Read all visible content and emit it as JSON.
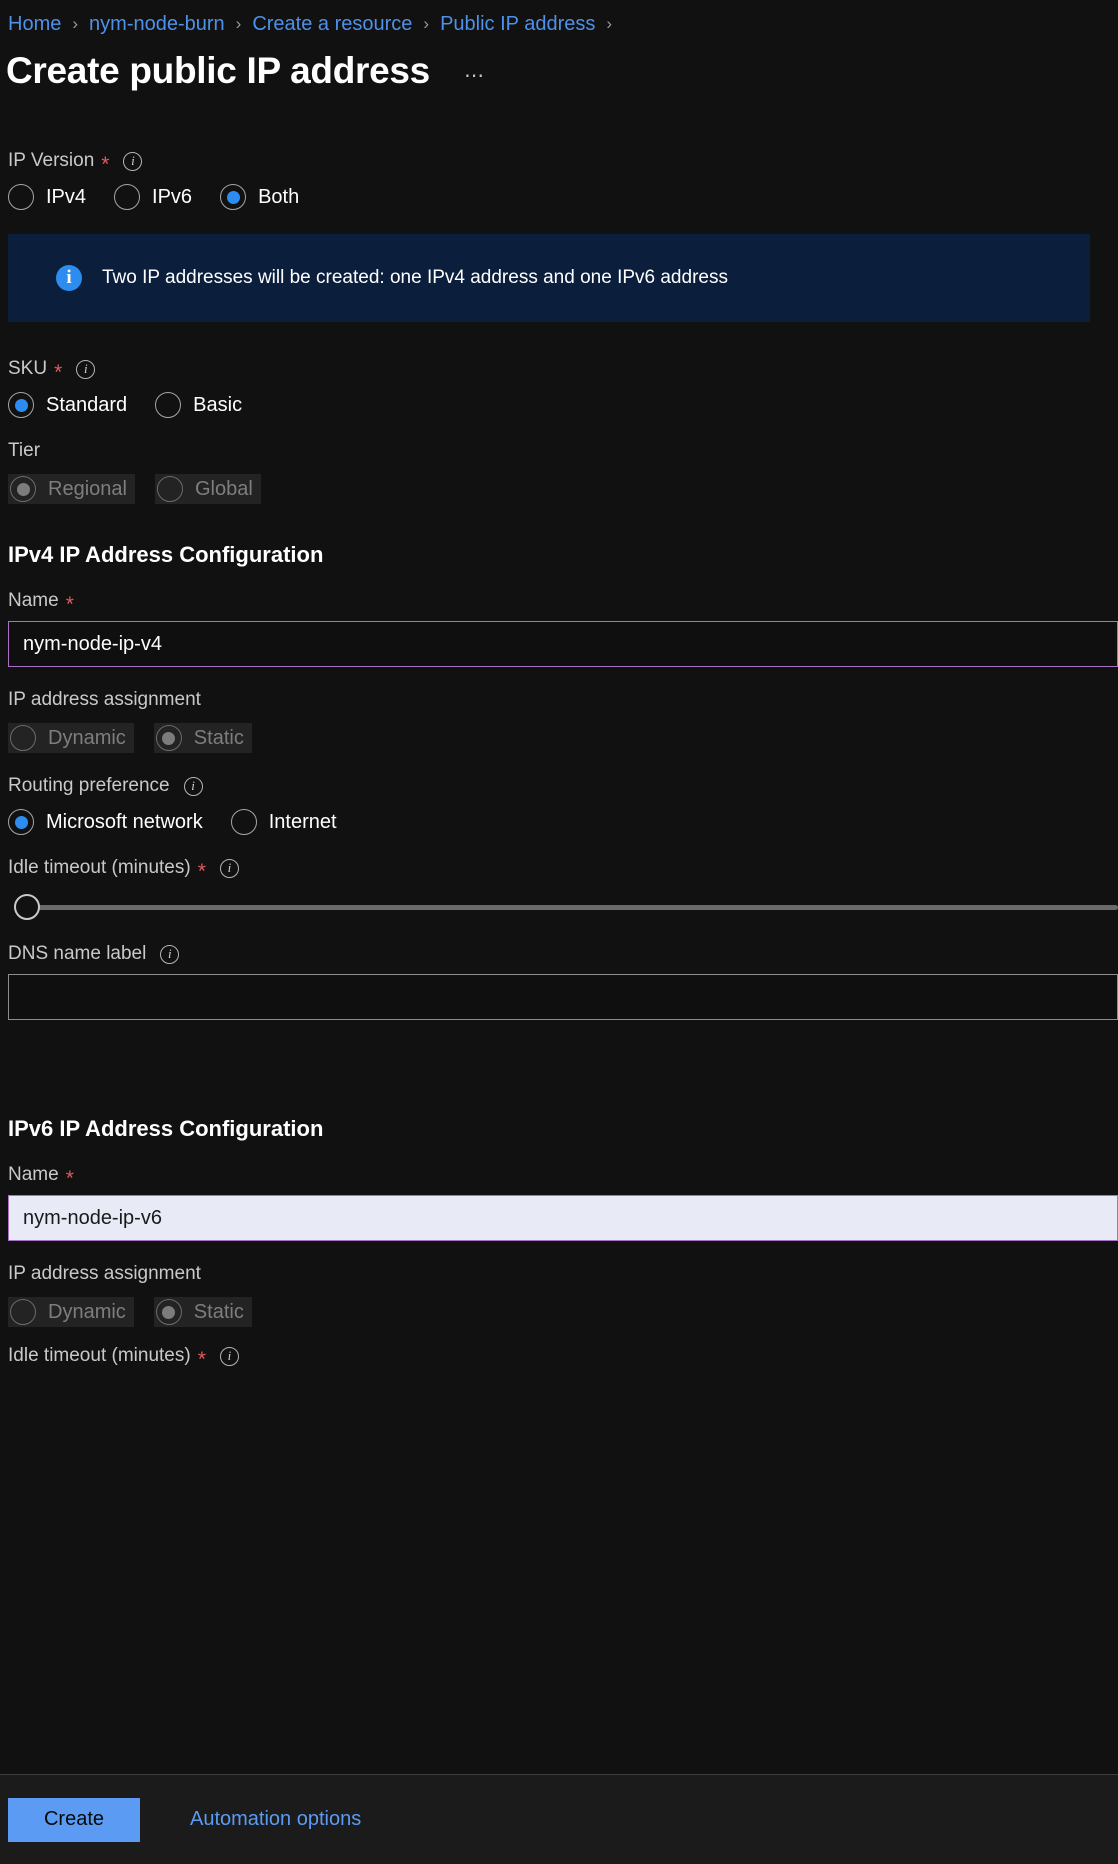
{
  "breadcrumb": {
    "items": [
      {
        "label": "Home"
      },
      {
        "label": "nym-node-burn"
      },
      {
        "label": "Create a resource"
      },
      {
        "label": "Public IP address"
      }
    ],
    "separator": "›"
  },
  "header": {
    "title": "Create public IP address",
    "more_label": "⋯"
  },
  "icons": {
    "info": "i",
    "banner_info": "i"
  },
  "ip_version": {
    "label": "IP Version",
    "required_marker": "*",
    "options": [
      {
        "label": "IPv4",
        "selected": false
      },
      {
        "label": "IPv6",
        "selected": false
      },
      {
        "label": "Both",
        "selected": true
      }
    ]
  },
  "info_banner": {
    "text": "Two IP addresses will be created: one IPv4 address and one IPv6 address",
    "background": "#0b1f3d",
    "accent": "#2d8cf0"
  },
  "sku": {
    "label": "SKU",
    "required_marker": "*",
    "options": [
      {
        "label": "Standard",
        "selected": true
      },
      {
        "label": "Basic",
        "selected": false
      }
    ]
  },
  "tier": {
    "label": "Tier",
    "disabled": true,
    "options": [
      {
        "label": "Regional",
        "selected": true
      },
      {
        "label": "Global",
        "selected": false
      }
    ]
  },
  "ipv4_section": {
    "heading": "IPv4 IP Address Configuration",
    "name": {
      "label": "Name",
      "required_marker": "*",
      "value": "nym-node-ip-v4",
      "placeholder": ""
    },
    "assignment": {
      "label": "IP address assignment",
      "disabled": true,
      "options": [
        {
          "label": "Dynamic",
          "selected": false
        },
        {
          "label": "Static",
          "selected": true
        }
      ]
    },
    "routing_preference": {
      "label": "Routing preference",
      "options": [
        {
          "label": "Microsoft network",
          "selected": true
        },
        {
          "label": "Internet",
          "selected": false
        }
      ]
    },
    "idle_timeout": {
      "label": "Idle timeout (minutes)",
      "required_marker": "*"
    },
    "dns_name_label": {
      "label": "DNS name label",
      "value": "",
      "placeholder": ""
    }
  },
  "ipv6_section": {
    "heading": "IPv6 IP Address Configuration",
    "name": {
      "label": "Name",
      "required_marker": "*",
      "value": "nym-node-ip-v6",
      "placeholder": ""
    },
    "assignment": {
      "label": "IP address assignment",
      "disabled": true,
      "options": [
        {
          "label": "Dynamic",
          "selected": false
        },
        {
          "label": "Static",
          "selected": true
        }
      ]
    },
    "idle_timeout": {
      "label": "Idle timeout (minutes)",
      "required_marker": "*"
    }
  },
  "action_bar": {
    "create_label": "Create",
    "automation_label": "Automation options",
    "create_color": "#5b9bf3"
  }
}
